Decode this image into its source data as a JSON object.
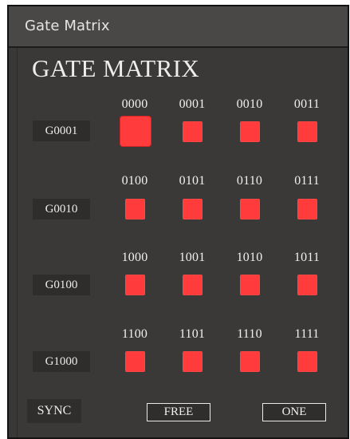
{
  "window": {
    "title": "Gate Matrix"
  },
  "panel": {
    "heading": "GATE MATRIX"
  },
  "rows": [
    {
      "gate": "G0001",
      "codes": [
        "0000",
        "0001",
        "0010",
        "0011"
      ]
    },
    {
      "gate": "G0010",
      "codes": [
        "0100",
        "0101",
        "0110",
        "0111"
      ]
    },
    {
      "gate": "G0100",
      "codes": [
        "1000",
        "1001",
        "1010",
        "1011"
      ]
    },
    {
      "gate": "G1000",
      "codes": [
        "1100",
        "1101",
        "1110",
        "1111"
      ]
    }
  ],
  "footer": {
    "sync_label": "SYNC",
    "free_label": "FREE",
    "one_label": "ONE"
  },
  "colors": {
    "pad": "#ff3b3b",
    "background": "#3b3937"
  }
}
